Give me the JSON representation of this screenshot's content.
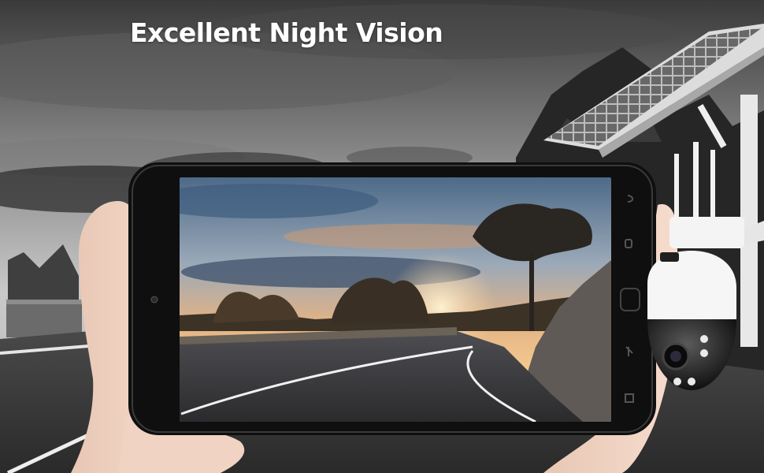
{
  "headline": "Excellent Night Vision",
  "scene": {
    "background": "grayscale-road-landscape",
    "device": "tablet-in-hands",
    "screen_content": "sunset-road-landscape",
    "product": "solar-powered-ptz-security-camera"
  },
  "icons": {
    "tablet_nav": [
      "back-icon",
      "menu-icon",
      "home-button",
      "search-icon",
      "windows-icon"
    ],
    "tablet_camera": "front-camera-icon"
  },
  "colors": {
    "headline": "#ffffff",
    "sky_gray": "#8a8a8a",
    "sunset_orange": "#e08a4a",
    "sky_blue": "#6f8aa6",
    "tablet_bezel": "#111111",
    "camera_white": "#f2f2f2"
  }
}
